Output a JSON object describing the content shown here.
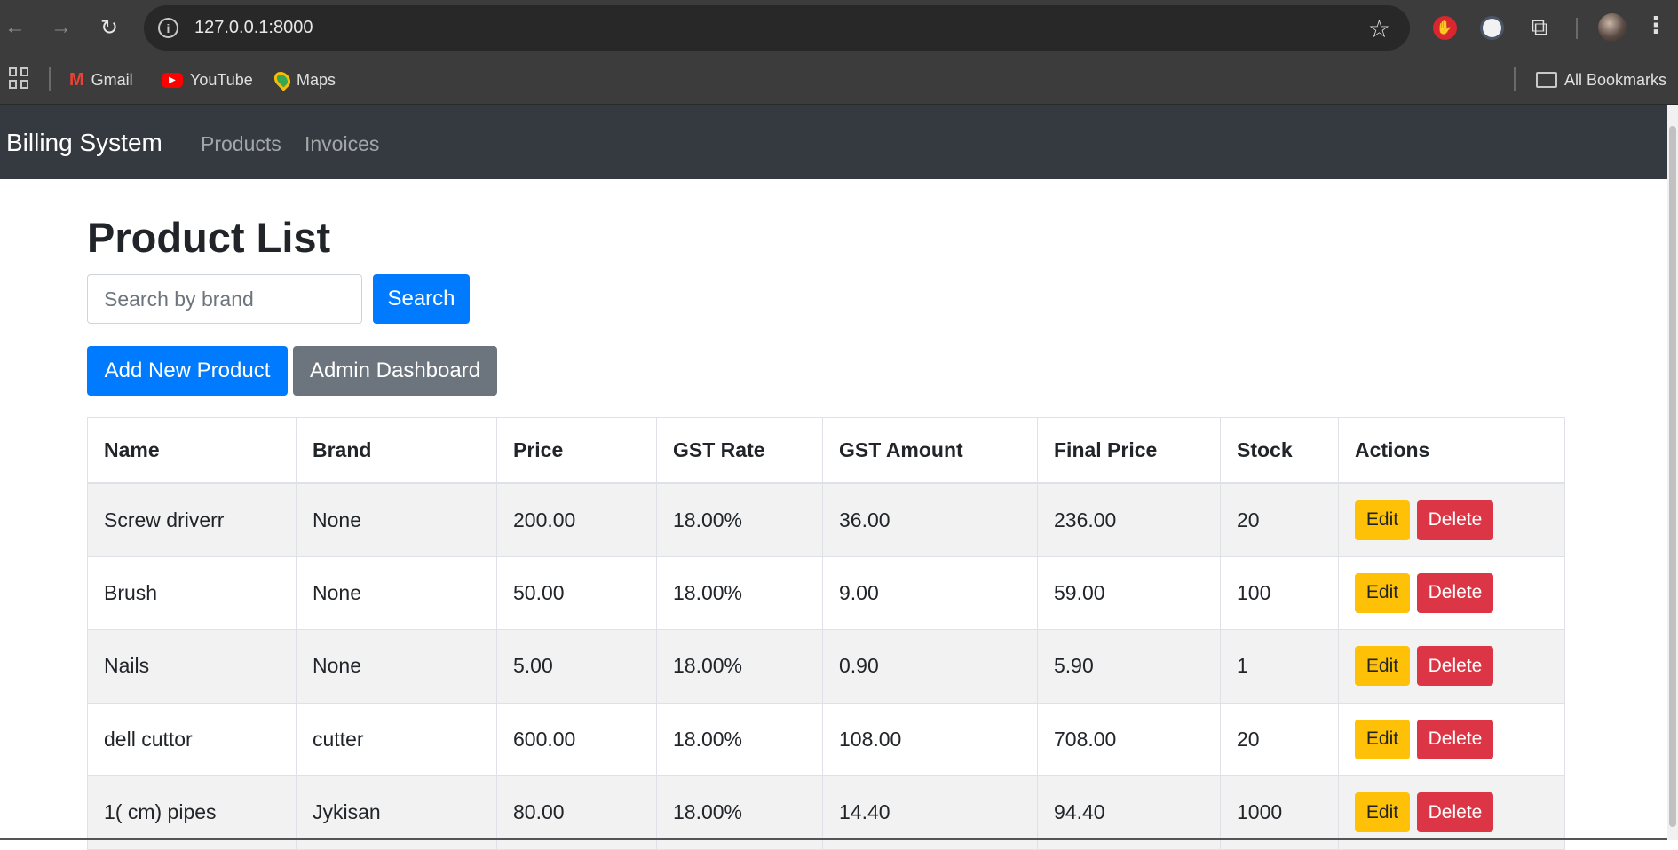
{
  "browser": {
    "url": "127.0.0.1:8000",
    "bookmarks": [
      {
        "label": "Gmail"
      },
      {
        "label": "YouTube"
      },
      {
        "label": "Maps"
      }
    ],
    "all_bookmarks": "All Bookmarks"
  },
  "navbar": {
    "brand": "Billing System",
    "links": [
      "Products",
      "Invoices"
    ]
  },
  "page": {
    "title": "Product List",
    "search_placeholder": "Search by brand",
    "search_button": "Search",
    "add_button": "Add New Product",
    "admin_button": "Admin Dashboard"
  },
  "table": {
    "headers": [
      "Name",
      "Brand",
      "Price",
      "GST Rate",
      "GST Amount",
      "Final Price",
      "Stock",
      "Actions"
    ],
    "edit_label": "Edit",
    "delete_label": "Delete",
    "rows": [
      {
        "name": "Screw driverr",
        "brand": "None",
        "price": "200.00",
        "gst_rate": "18.00%",
        "gst_amount": "36.00",
        "final_price": "236.00",
        "stock": "20"
      },
      {
        "name": "Brush",
        "brand": "None",
        "price": "50.00",
        "gst_rate": "18.00%",
        "gst_amount": "9.00",
        "final_price": "59.00",
        "stock": "100"
      },
      {
        "name": "Nails",
        "brand": "None",
        "price": "5.00",
        "gst_rate": "18.00%",
        "gst_amount": "0.90",
        "final_price": "5.90",
        "stock": "1"
      },
      {
        "name": "dell cuttor",
        "brand": "cutter",
        "price": "600.00",
        "gst_rate": "18.00%",
        "gst_amount": "108.00",
        "final_price": "708.00",
        "stock": "20"
      },
      {
        "name": "1( cm) pipes",
        "brand": "Jykisan",
        "price": "80.00",
        "gst_rate": "18.00%",
        "gst_amount": "14.40",
        "final_price": "94.40",
        "stock": "1000"
      }
    ]
  }
}
